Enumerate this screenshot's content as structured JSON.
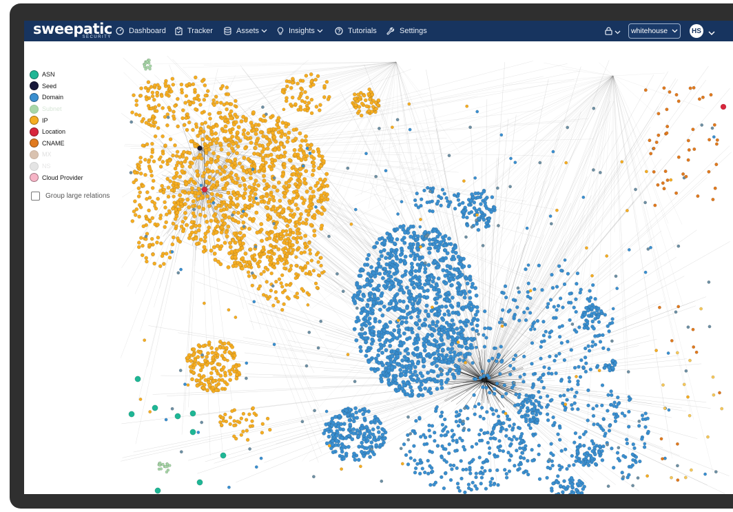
{
  "app": {
    "logo": "sweepatic",
    "logo_sub": "SECURITY"
  },
  "nav": {
    "dashboard": "Dashboard",
    "tracker": "Tracker",
    "assets": "Assets",
    "insights": "Insights",
    "tutorials": "Tutorials",
    "settings": "Settings",
    "workspace": "whitehouse",
    "avatar": "HS"
  },
  "legend": [
    {
      "label": "ASN",
      "color": "#1fb695"
    },
    {
      "label": "Seed",
      "color": "#17183a"
    },
    {
      "label": "Domain",
      "color": "#3a8fd0"
    },
    {
      "label": "Subnet",
      "color": "#a8d7a8"
    },
    {
      "label": "IP",
      "color": "#f5ad22"
    },
    {
      "label": "Location",
      "color": "#d8263c"
    },
    {
      "label": "CNAME",
      "color": "#e07a1f"
    },
    {
      "label": "MX",
      "color": "#d9c2b0"
    },
    {
      "label": "NS",
      "color": "#e4e4e4"
    },
    {
      "label": "Cloud Provider",
      "color": "#f6b4c6"
    }
  ],
  "group_label": "Group large relations",
  "colors": {
    "navbar": "#17345f",
    "ip": "#f5ad22",
    "domain": "#3a8fd0",
    "asn": "#1fb695",
    "seed": "#111111",
    "location": "#d8263c",
    "cname": "#e07a1f"
  }
}
